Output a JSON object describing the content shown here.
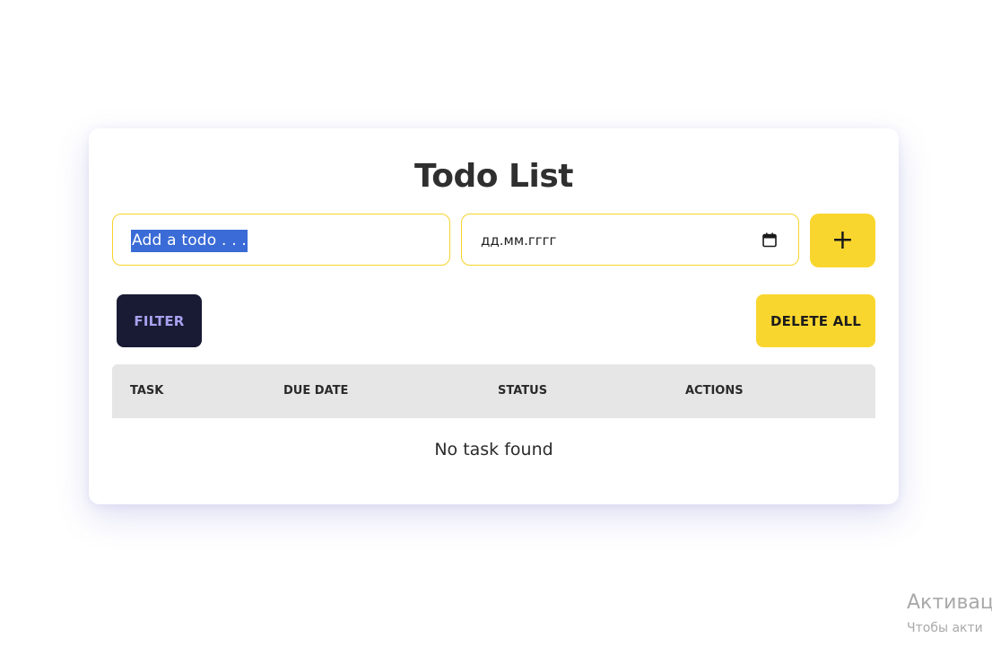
{
  "app": {
    "title": "Todo List"
  },
  "form": {
    "todo_placeholder": "Add a todo . . .",
    "date_placeholder": "дд.мм.гггг",
    "add_label": "+"
  },
  "toolbar": {
    "filter_label": "FILTER",
    "delete_all_label": "DELETE ALL"
  },
  "table": {
    "columns": [
      "TASK",
      "DUE DATE",
      "STATUS",
      "ACTIONS"
    ],
    "empty_message": "No task found"
  },
  "watermark": {
    "line1": "Активац",
    "line2": "Чтобы акти"
  },
  "colors": {
    "accent": "#f9d62e",
    "filter_bg": "#191a33",
    "filter_text": "#a8a1ef",
    "header_bg": "#e6e6e6",
    "selection": "#3a6bd6"
  },
  "icons": {
    "date_picker": "calendar-icon",
    "add": "plus-icon"
  }
}
